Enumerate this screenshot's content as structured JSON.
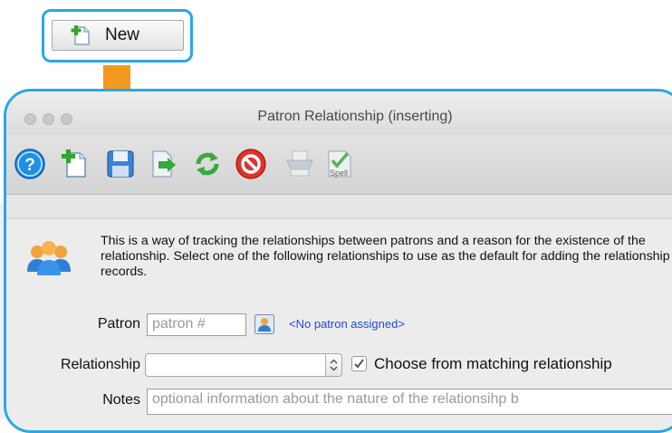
{
  "callout": {
    "new_label": "New"
  },
  "window": {
    "title": "Patron Relationship (inserting)",
    "toolbar": {
      "icons": [
        "help-icon",
        "new-icon",
        "save-icon",
        "export-icon",
        "refresh-icon",
        "cancel-icon",
        "print-icon",
        "spell-icon"
      ],
      "spell_label": "Spell"
    },
    "description": "This is a way of tracking the relationships between patrons and a reason for the existence of the relationship.  Select one of the following relationships to use as the default for adding the relationship records.",
    "form": {
      "patron_label": "Patron",
      "patron_placeholder": "patron #",
      "no_patron_text": "<No patron assigned>",
      "relationship_label": "Relationship",
      "relationship_value": "",
      "choose_matching_label": "Choose from matching relationship",
      "choose_matching_checked": true,
      "notes_label": "Notes",
      "notes_placeholder": "optional information about the nature of the relationsihp b"
    }
  },
  "colors": {
    "callout_border": "#2aa7e8",
    "arrow": "#f39a1e",
    "link": "#1f4bd9"
  }
}
